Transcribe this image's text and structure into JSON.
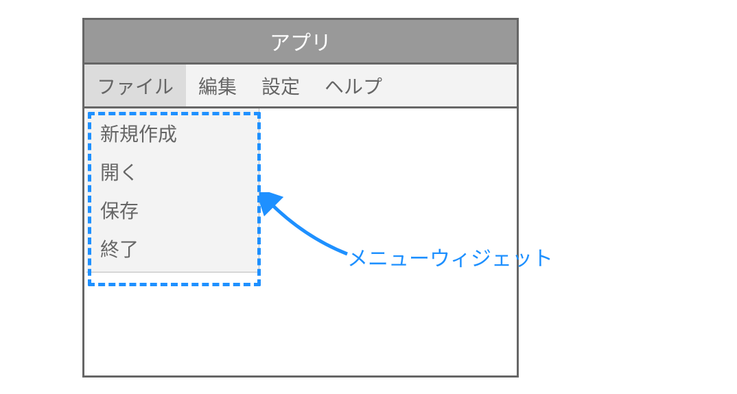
{
  "title": "アプリ",
  "menubar": {
    "items": [
      {
        "label": "ファイル",
        "active": true
      },
      {
        "label": "編集",
        "active": false
      },
      {
        "label": "設定",
        "active": false
      },
      {
        "label": "ヘルプ",
        "active": false
      }
    ]
  },
  "dropdown": {
    "items": [
      {
        "label": "新規作成"
      },
      {
        "label": "開く"
      },
      {
        "label": "保存"
      },
      {
        "label": "終了"
      }
    ]
  },
  "annotation": {
    "label": "メニューウィジェット",
    "color": "#1E90FF"
  }
}
